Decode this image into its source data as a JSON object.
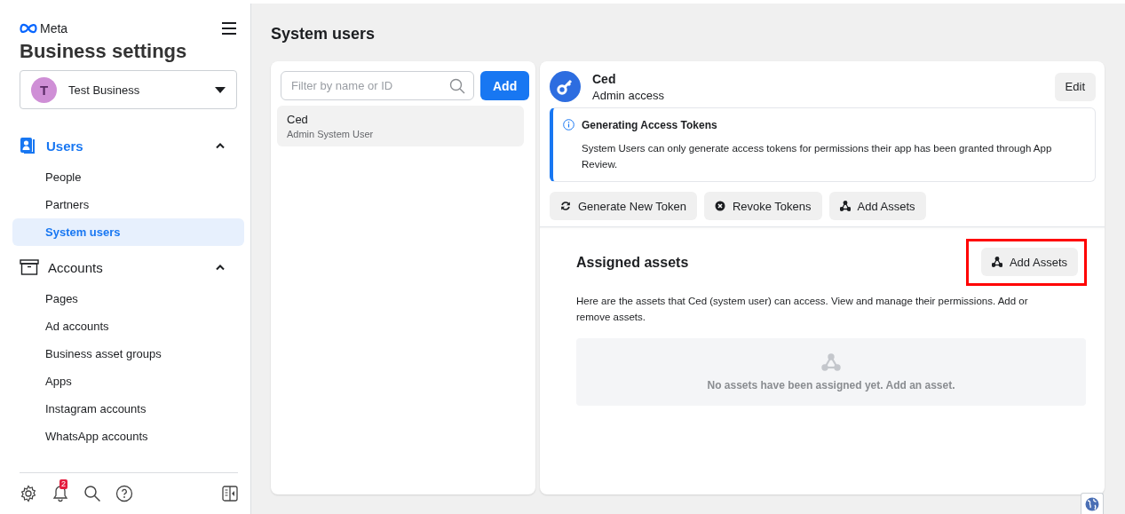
{
  "sidebar": {
    "brand": "Meta",
    "title": "Business settings",
    "business": {
      "initial": "T",
      "name": "Test Business"
    },
    "sections": [
      {
        "label": "Users",
        "selected": true,
        "expanded": true,
        "items": [
          {
            "label": "People",
            "selected": false
          },
          {
            "label": "Partners",
            "selected": false
          },
          {
            "label": "System users",
            "selected": true
          }
        ]
      },
      {
        "label": "Accounts",
        "selected": false,
        "expanded": true,
        "items": [
          {
            "label": "Pages",
            "selected": false
          },
          {
            "label": "Ad accounts",
            "selected": false
          },
          {
            "label": "Business asset groups",
            "selected": false
          },
          {
            "label": "Apps",
            "selected": false
          },
          {
            "label": "Instagram accounts",
            "selected": false
          },
          {
            "label": "WhatsApp accounts",
            "selected": false
          }
        ]
      }
    ],
    "notification_count": "2"
  },
  "page": {
    "title": "System users"
  },
  "user_list": {
    "search": {
      "placeholder": "Filter by name or ID"
    },
    "add_button": "Add",
    "users": [
      {
        "name": "Ced",
        "role": "Admin System User",
        "selected": true
      }
    ]
  },
  "detail": {
    "name": "Ced",
    "access": "Admin access",
    "edit_button": "Edit",
    "notice": {
      "title": "Generating Access Tokens",
      "text": "System Users can only generate access tokens for permissions their app has been granted through App Review."
    },
    "actions": [
      {
        "kind": "refresh",
        "label": "Generate New Token"
      },
      {
        "kind": "revoke",
        "label": "Revoke Tokens"
      },
      {
        "kind": "assets",
        "label": "Add Assets"
      }
    ],
    "assigned": {
      "title": "Assigned assets",
      "button": {
        "label": "Add Assets",
        "highlighted": true
      },
      "description": "Here are the assets that Ced (system user) can access. View and manage their permissions. Add or remove assets.",
      "empty_text": "No assets have been assigned yet. Add an asset."
    }
  }
}
